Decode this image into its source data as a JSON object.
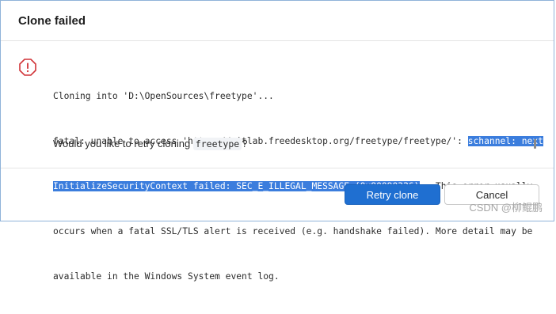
{
  "dialog": {
    "title": "Clone failed"
  },
  "message": {
    "line1": "Cloning into 'D:\\OpenSources\\freetype'...",
    "line2_prefix": "fatal: unable to access 'https://gitlab.freedesktop.org/freetype/freetype/': ",
    "line2_highlight": "schannel: next",
    "line3_highlight": "InitializeSecurityContext failed: SEC_E_ILLEGAL_MESSAGE (0x80090326)",
    "line3_suffix": " - This error usually",
    "line4": "occurs when a fatal SSL/TLS alert is received (e.g. handshake failed). More detail may be",
    "line5": "available in the Windows System event log."
  },
  "question": {
    "prefix": "Would you like to retry cloning ",
    "repo": "freetype",
    "suffix": "?"
  },
  "buttons": {
    "retry_label": "Retry clone",
    "cancel_label": "Cancel"
  },
  "watermark": "CSDN @柳鲲鹏",
  "colors": {
    "primary": "#1f6fd1",
    "error": "#d13438",
    "highlight": "#3b7ddd"
  },
  "icons": {
    "error": "error-icon"
  }
}
